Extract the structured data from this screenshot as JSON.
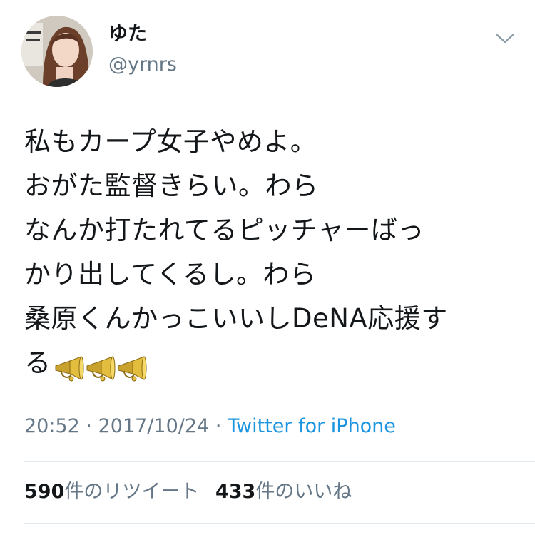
{
  "user": {
    "display_name": "ゆた",
    "handle": "@yrnrs"
  },
  "icons": {
    "avatar": "profile-photo",
    "caret": "chevron-down-icon",
    "emoji": "megaphone-icon"
  },
  "tweet": {
    "lines": [
      "私もカープ女子やめよ。",
      "おがた監督きらい。わら",
      "なんか打たれてるピッチャーばっ",
      "かり出してくるし。わら",
      "桑原くんかっこいいしDeNA応援す",
      "る"
    ],
    "emoji_count": 3
  },
  "meta": {
    "time": "20:52",
    "separator": "·",
    "date": "2017/10/24",
    "source": "Twitter for iPhone"
  },
  "stats": {
    "retweets_count": "590",
    "retweets_label": "件のリツイート",
    "likes_count": "433",
    "likes_label": "件のいいね"
  },
  "colors": {
    "text": "#14171a",
    "secondary": "#657786",
    "link": "#1b95e0",
    "divider": "#e1e8ed"
  }
}
